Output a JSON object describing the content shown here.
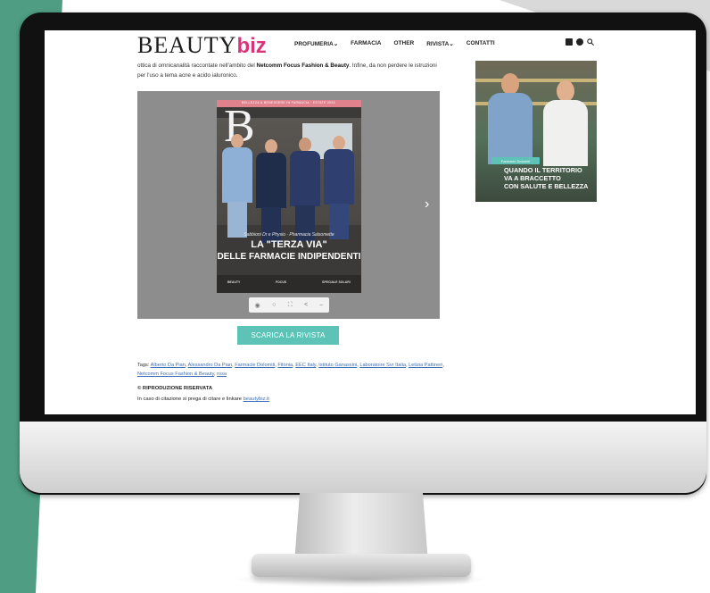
{
  "site": {
    "logo_main": "BEAUTY",
    "logo_accent": "biz"
  },
  "nav": [
    {
      "label": "PROFUMERIA",
      "chevron": "⌄"
    },
    {
      "label": "FARMACIA",
      "chevron": ""
    },
    {
      "label": "OTHER",
      "chevron": ""
    },
    {
      "label": "RIVISTA",
      "chevron": "⌄"
    },
    {
      "label": "CONTATTI",
      "chevron": ""
    }
  ],
  "article": {
    "intro_pre": "ottica di omnicanalità raccontate nell'ambito del ",
    "intro_bold": "Netcomm Focus Fashion & Beauty",
    "intro_post": ". Infine, da non perdere le istruzioni per l'uso a tema acne e acido ialuronico."
  },
  "magazine": {
    "header_strip": "BELLEZZA & BENESSERE IN FARMACIA · ESTATE 2024",
    "cover_letter": "B",
    "kicker": "Sabbioni Dr e Physio · Pharmacia Salsomette",
    "title_line1": "LA \"TERZA VIA\"",
    "title_line2": "DELLE FARMACIE INDIPENDENTI",
    "foot_left": "BEAUTY",
    "foot_mid": "FOCUS",
    "foot_right": "SPECIALE SOLARI",
    "next_arrow": "›",
    "controls": [
      "◉",
      "○",
      "⛶",
      "<",
      "–"
    ]
  },
  "download_button": "SCARICA LA RIVISTA",
  "tags": {
    "label": "Tags: ",
    "items": [
      "Alberto Da Pian",
      "Alessandro Da Pian",
      "Farmacie Dolomiti",
      "Fitonia",
      "EEC Italy",
      "Istituto Ganassini",
      "Laboratoire Svr Italia",
      "Letizia Pattineri",
      "Netcomm Focus Fashion & Beauty",
      "rosa"
    ]
  },
  "footer": {
    "rights": "© RIPRODUZIONE RISERVATA",
    "cite_text": "In caso di citazione si prega di citare e linkare ",
    "cite_link": "beautybiz.it"
  },
  "ad": {
    "badge": "Farmacie Dolomiti",
    "line1": "QUANDO IL TERRITORIO",
    "line2": "VA A BRACCETTO",
    "line3": "CON SALUTE E BELLEZZA"
  },
  "colors": {
    "accent_pink": "#d9347a",
    "accent_teal": "#5cc3b6",
    "background_green": "#4f9d83"
  }
}
